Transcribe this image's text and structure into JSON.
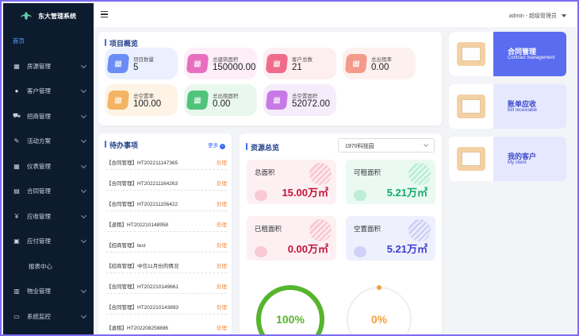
{
  "app": {
    "name": "东大管理系统"
  },
  "sidebar": {
    "items": [
      {
        "label": "首页",
        "icon": "home",
        "active": true
      },
      {
        "label": "房源管理",
        "icon": "grid-icon"
      },
      {
        "label": "客户管理",
        "icon": "user-icon"
      },
      {
        "label": "招商管理",
        "icon": "car-icon"
      },
      {
        "label": "活动方案",
        "icon": "pen-icon"
      },
      {
        "label": "仪表管理",
        "icon": "grid-icon"
      },
      {
        "label": "合同管理",
        "icon": "file-icon"
      },
      {
        "label": "应收管理",
        "icon": "money-icon"
      },
      {
        "label": "应付管理",
        "icon": "lock-icon"
      },
      {
        "label": "报表中心",
        "icon": ""
      },
      {
        "label": "物业管理",
        "icon": "building-icon"
      },
      {
        "label": "系统监控",
        "icon": "monitor-icon"
      }
    ]
  },
  "header": {
    "user": "admin - 超级管理员"
  },
  "overview": {
    "title": "项目概览",
    "items": [
      {
        "label": "项目数量",
        "value": "5",
        "color": "#6b8cf5",
        "bg": "#eaf0ff"
      },
      {
        "label": "总建筑面积",
        "value": "150000.00",
        "color": "#e86fc0",
        "bg": "#fdeef8"
      },
      {
        "label": "客户总数",
        "value": "21",
        "color": "#f06b8a",
        "bg": "#fdeef1"
      },
      {
        "label": "总出租率",
        "value": "0.00",
        "color": "#f39a8a",
        "bg": "#fdf1ee"
      },
      {
        "label": "总空置率",
        "value": "100.00",
        "color": "#f5b463",
        "bg": "#fef4e6"
      },
      {
        "label": "总出租面积",
        "value": "0.00",
        "color": "#4fc47a",
        "bg": "#e9f8ee"
      },
      {
        "label": "总空置面积",
        "value": "52072.00",
        "color": "#c77ae6",
        "bg": "#f6edfc"
      }
    ]
  },
  "todo": {
    "title": "待办事项",
    "more": "更多",
    "action": "处理",
    "items": [
      "【合同管理】HT202211147365",
      "【合同管理】HT202211164263",
      "【合同管理】HT202211156422",
      "【退租】HT202210148958",
      "【招商管理】test",
      "【招商管理】中信11月份的情况",
      "【合同管理】HT202210149661",
      "【合同管理】HT202210143893",
      "【退租】HT202208258896"
    ]
  },
  "resources": {
    "title": "资源总览",
    "select_value": "1970科技园",
    "areas": [
      {
        "label": "总面积",
        "value": "15.00万㎡",
        "color": "#c0143c",
        "bg": "#fdf0f3",
        "stripe": "#f9c9d4"
      },
      {
        "label": "可租面积",
        "value": "5.21万㎡",
        "color": "#12a86a",
        "bg": "#eaf9f2",
        "stripe": "#bdeed7"
      },
      {
        "label": "已租面积",
        "value": "0.00万㎡",
        "color": "#c0143c",
        "bg": "#fdf0f3",
        "stripe": "#f9c9d4"
      },
      {
        "label": "空置面积",
        "value": "5.21万㎡",
        "color": "#3b3ed1",
        "bg": "#eff0fd",
        "stripe": "#cfd1f6"
      }
    ],
    "rings": [
      {
        "label": "100%",
        "value": 100,
        "color": "#55b52c"
      },
      {
        "label": "0%",
        "value": 0,
        "color": "#f0a03c"
      }
    ]
  },
  "quick": [
    {
      "title": "合同管理",
      "sub": "Contract management",
      "bg": "#5a6cf0",
      "text": "#ffffff"
    },
    {
      "title": "账单应收",
      "sub": "Bill receivable",
      "bg": "#e6e8ff",
      "text": "#3b48c9"
    },
    {
      "title": "我的客户",
      "sub": "My client",
      "bg": "#e6e8ff",
      "text": "#3b48c9"
    }
  ]
}
